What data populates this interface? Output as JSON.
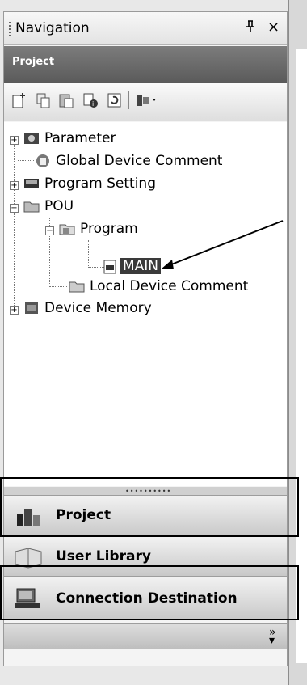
{
  "panel": {
    "title": "Navigation",
    "pin_glyph": "q",
    "close_glyph": "×",
    "section": "Project"
  },
  "toolbar": {
    "icons": [
      "new-data-icon",
      "copy-icon",
      "paste-icon",
      "properties-icon",
      "refresh-icon",
      "sort-icon"
    ]
  },
  "tree": {
    "items": [
      {
        "label": "Parameter",
        "icon": "parameter-icon"
      },
      {
        "label": "Global Device Comment",
        "icon": "comment-icon"
      },
      {
        "label": "Program Setting",
        "icon": "program-setting-icon"
      },
      {
        "label": "POU",
        "icon": "folder-icon"
      },
      {
        "label": "Program",
        "icon": "program-folder-icon"
      },
      {
        "label": "MAIN",
        "icon": "program-file-icon"
      },
      {
        "label": "Local Device Comment",
        "icon": "local-comment-icon"
      },
      {
        "label": "Device Memory",
        "icon": "device-memory-icon"
      }
    ]
  },
  "nav_buttons": [
    {
      "label": "Project",
      "icon": "project-icon"
    },
    {
      "label": "User Library",
      "icon": "library-icon"
    },
    {
      "label": "Connection Destination",
      "icon": "connection-icon"
    }
  ],
  "overflow_glyph": "»",
  "colors": {
    "selected_bg": "#3a3a3a",
    "header_bg": "#6a6a6a"
  }
}
